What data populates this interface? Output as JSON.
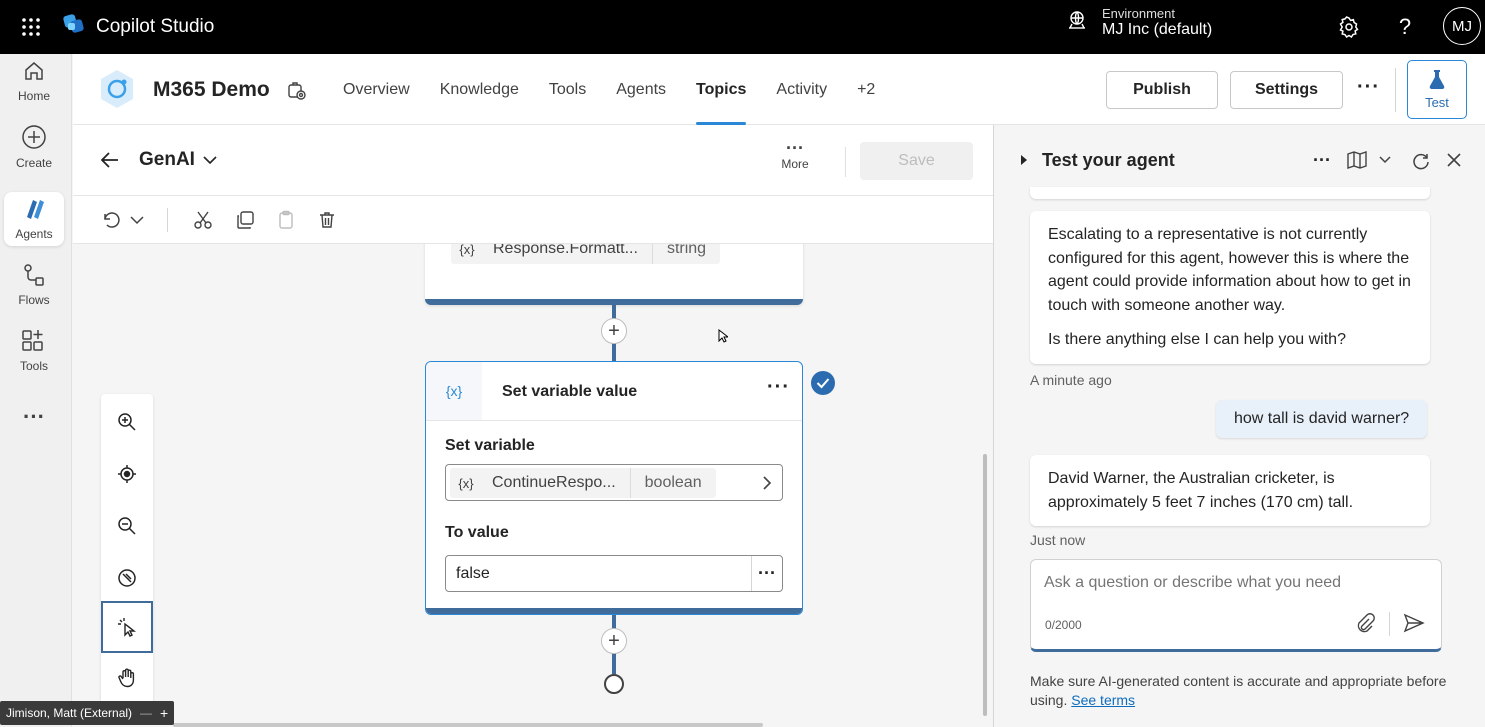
{
  "topbar": {
    "app_name": "Copilot Studio",
    "env_label": "Environment",
    "env_value": "MJ Inc (default)",
    "avatar_initials": "MJ"
  },
  "rail": {
    "items": [
      {
        "label": "Home",
        "icon": "home-icon"
      },
      {
        "label": "Create",
        "icon": "plus-circle-icon"
      },
      {
        "label": "Agents",
        "icon": "agents-icon"
      },
      {
        "label": "Flows",
        "icon": "flows-icon"
      },
      {
        "label": "Tools",
        "icon": "tools-icon"
      }
    ]
  },
  "header": {
    "agent_name": "M365 Demo",
    "tabs": [
      {
        "label": "Overview"
      },
      {
        "label": "Knowledge"
      },
      {
        "label": "Tools"
      },
      {
        "label": "Agents"
      },
      {
        "label": "Topics"
      },
      {
        "label": "Activity"
      },
      {
        "label": "+2"
      }
    ],
    "active_tab": "Topics",
    "publish_label": "Publish",
    "settings_label": "Settings",
    "test_label": "Test"
  },
  "topic": {
    "name": "GenAI",
    "more_label": "More",
    "save_label": "Save"
  },
  "canvas": {
    "top_node": {
      "var_name": "Response.Formatt...",
      "var_type": "string"
    },
    "node": {
      "icon_text": "{x}",
      "title": "Set variable value",
      "set_variable_label": "Set variable",
      "var_icon": "{x}",
      "var_name": "ContinueRespo...",
      "var_type": "boolean",
      "to_value_label": "To value",
      "to_value": "false"
    }
  },
  "user_tag": "Jimison, Matt (External)",
  "test_panel": {
    "title": "Test your agent",
    "bot_message_1_p1": "Escalating to a representative is not currently configured for this agent, however this is where the agent could provide information about how to get in touch with someone another way.",
    "bot_message_1_p2": "Is there anything else I can help you with?",
    "timestamp_1": "A minute ago",
    "user_message": "how tall is david warner?",
    "bot_message_2": "David Warner, the Australian cricketer, is approximately 5 feet 7 inches (170 cm) tall.",
    "timestamp_2": "Just now",
    "input_placeholder": "Ask a question or describe what you need",
    "char_count": "0/2000",
    "disclaimer": "Make sure AI-generated content is accurate and appropriate before using.",
    "terms_link": "See terms"
  },
  "colors": {
    "accent": "#2b88d8",
    "node_border": "#3f6c9b",
    "topbar_bg": "#000000"
  }
}
